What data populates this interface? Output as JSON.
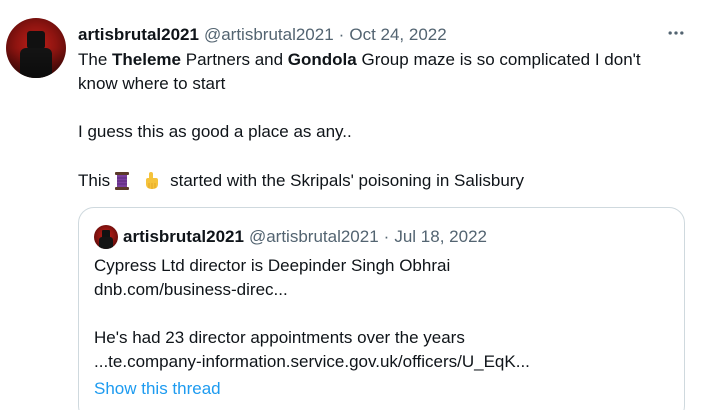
{
  "tweet": {
    "display_name": "artisbrutal2021",
    "handle": "@artisbrutal2021",
    "separator": "·",
    "date": "Oct 24, 2022",
    "more_icon": "more-horizontal-icon",
    "text": {
      "l1_a": "The ",
      "l1_b": "Theleme",
      "l1_c": " Partners and ",
      "l1_d": "Gondola",
      "l1_e": " Group maze is so complicated I don't",
      "l2": "know where to start",
      "l3": "I guess this as good a place as any..",
      "l4_a": "This",
      "l4_b": "started with the Skripals' poisoning in Salisbury"
    },
    "emojis": [
      "thread-spool-icon",
      "pointing-down-icon"
    ]
  },
  "quote": {
    "display_name": "artisbrutal2021",
    "handle": "@artisbrutal2021",
    "separator": "·",
    "date": "Jul 18, 2022",
    "lines": [
      "Cypress Ltd director is Deepinder Singh Obhrai",
      "dnb.com/business-direc...",
      "He's had 23 director appointments over the years",
      "...te.company-information.service.gov.uk/officers/U_EqK..."
    ],
    "show_thread": "Show this thread"
  },
  "colors": {
    "text": "#0f1419",
    "secondary": "#536471",
    "link": "#1d9bf0",
    "border": "#cfd9de"
  }
}
